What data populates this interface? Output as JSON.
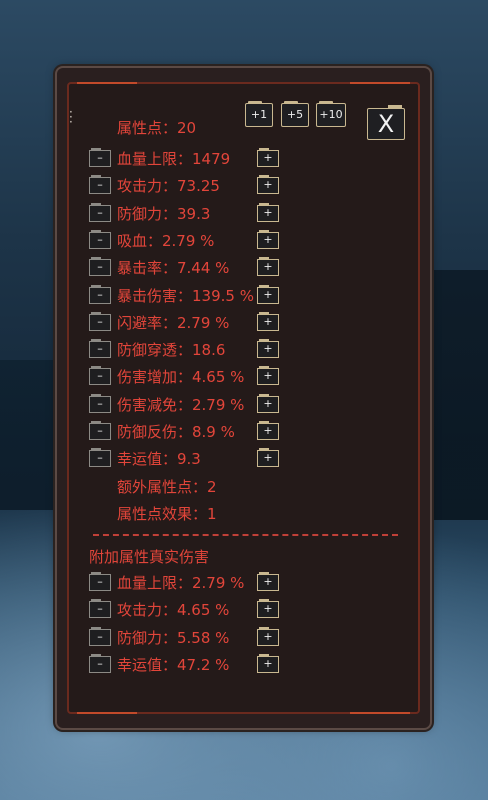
{
  "panel": {
    "attribute_points": "属性点：20",
    "buttons": {
      "plus1": "+1",
      "plus5": "+5",
      "plus10": "+10",
      "close": "X"
    },
    "stats": [
      {
        "label": "血量上限：1479"
      },
      {
        "label": "攻击力：73.25"
      },
      {
        "label": "防御力：39.3"
      },
      {
        "label": "吸血：2.79 %"
      },
      {
        "label": "暴击率：7.44 %"
      },
      {
        "label": "暴击伤害：139.5 %"
      },
      {
        "label": "闪避率：2.79 %"
      },
      {
        "label": "防御穿透：18.6"
      },
      {
        "label": "伤害增加：4.65 %"
      },
      {
        "label": "伤害减免：2.79 %"
      },
      {
        "label": "防御反伤：8.9 %"
      },
      {
        "label": "幸运值：9.3"
      }
    ],
    "extra_points": "额外属性点：2",
    "points_effect": "属性点效果：1",
    "true_damage_title": "附加属性真实伤害",
    "true_damage": [
      {
        "label": "血量上限：2.79 %"
      },
      {
        "label": "攻击力：4.65 %"
      },
      {
        "label": "防御力：5.58 %"
      },
      {
        "label": "幸运值：47.2 %"
      }
    ]
  },
  "colors": {
    "text": "#e2453a",
    "border": "#6b2a1e",
    "panel": "#241a19"
  }
}
